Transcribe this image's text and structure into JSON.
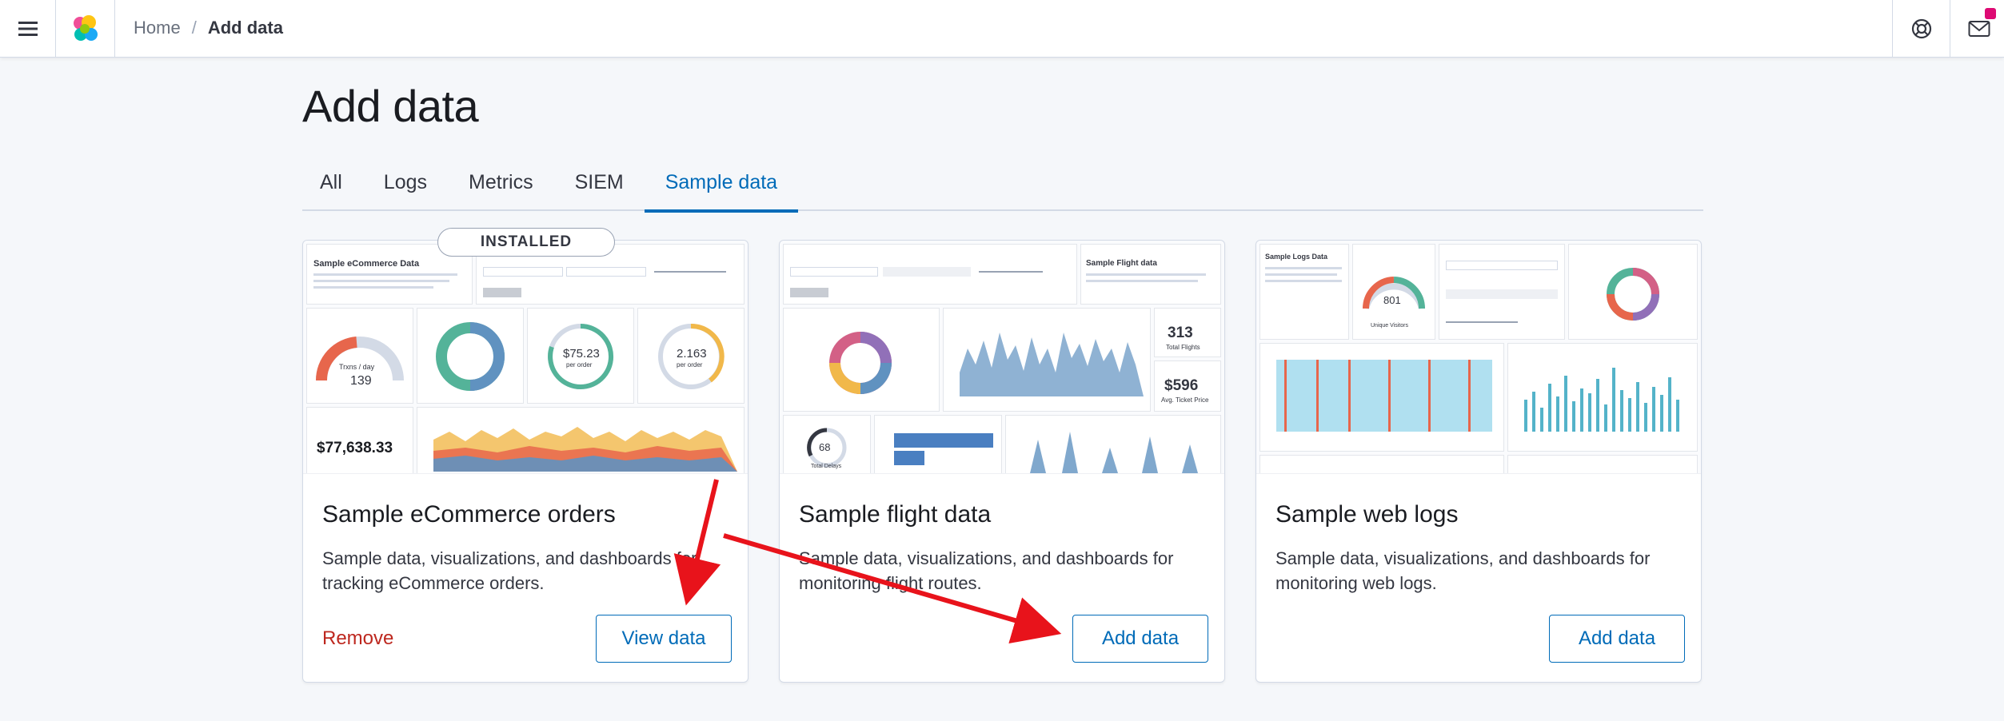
{
  "header": {
    "menu_icon": "hamburger-icon",
    "logo_icon": "kibana-logo-icon",
    "breadcrumbs": [
      "Home",
      "Add data"
    ],
    "separator": "/",
    "help_icon": "help-lifebuoy-icon",
    "mail_icon": "mail-icon",
    "accent": "#dd0a73"
  },
  "page": {
    "title": "Add data"
  },
  "tabs": [
    {
      "label": "All",
      "active": false
    },
    {
      "label": "Logs",
      "active": false
    },
    {
      "label": "Metrics",
      "active": false
    },
    {
      "label": "SIEM",
      "active": false
    },
    {
      "label": "Sample data",
      "active": true
    }
  ],
  "cards": [
    {
      "badge": "INSTALLED",
      "title": "Sample eCommerce orders",
      "description": "Sample data, visualizations, and dashboards for tracking eCommerce orders.",
      "secondary_action": "Remove",
      "primary_action": "View data",
      "thumb": {
        "heading": "Sample eCommerce Data",
        "gauge_label": "Trxns / day",
        "gauge_value": "139",
        "avg_price": "$75.23",
        "avg_price_sub": "per order",
        "avg_qty": "2.163",
        "avg_qty_sub": "per order",
        "revenue": "$77,638.33"
      }
    },
    {
      "title": "Sample flight data",
      "description": "Sample data, visualizations, and dashboards for monitoring flight routes.",
      "primary_action": "Add data",
      "thumb": {
        "heading": "Sample Flight data",
        "total_flights": "313",
        "total_flights_label": "Total Flights",
        "avg_ticket": "$596",
        "avg_ticket_label": "Avg. Ticket Price",
        "delays": "68",
        "delays_label": "Total Delays"
      }
    },
    {
      "title": "Sample web logs",
      "description": "Sample data, visualizations, and dashboards for monitoring web logs.",
      "primary_action": "Add data",
      "thumb": {
        "heading": "Sample Logs Data",
        "gauge_value": "801",
        "gauge_label": "Unique Visitors"
      }
    }
  ],
  "colors": {
    "primary": "#006bb8",
    "danger": "#bd271e",
    "annotation_arrow": "#e8131b"
  }
}
